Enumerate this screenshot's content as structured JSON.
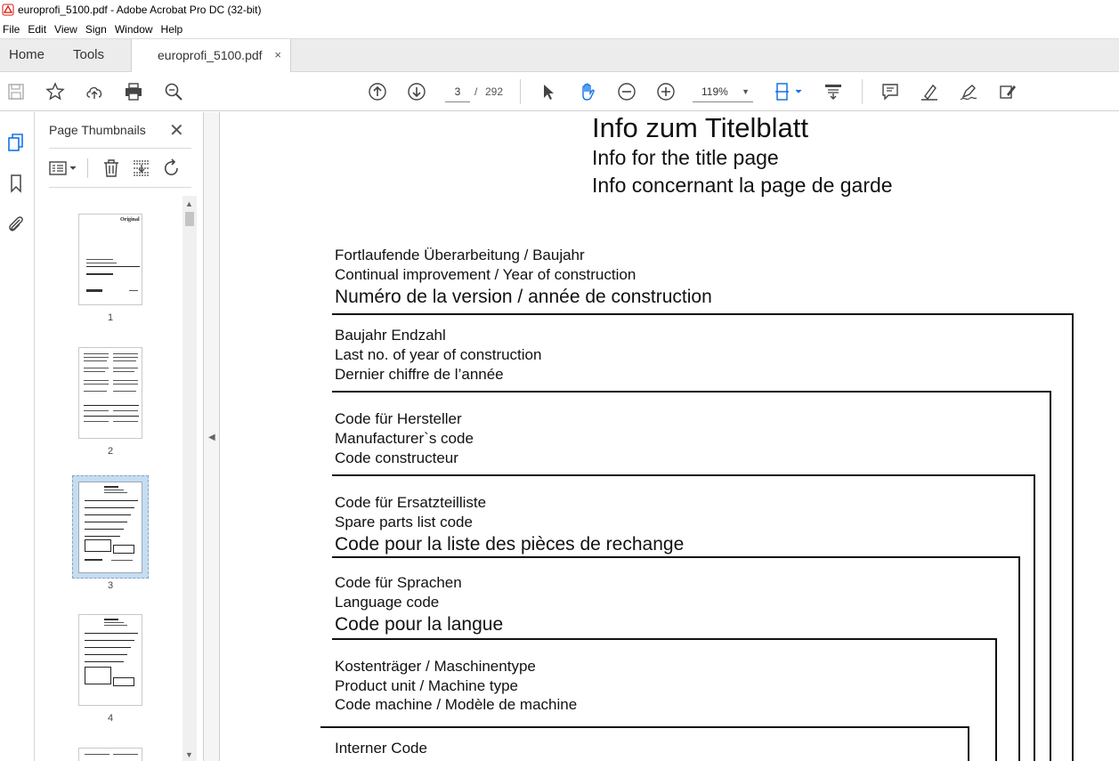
{
  "window": {
    "title": "europrofi_5100.pdf - Adobe Acrobat Pro DC (32-bit)"
  },
  "menu": {
    "items": [
      "File",
      "Edit",
      "View",
      "Sign",
      "Window",
      "Help"
    ]
  },
  "tabs": {
    "home": "Home",
    "tools": "Tools",
    "document": "europrofi_5100.pdf",
    "close_glyph": "×"
  },
  "toolbar": {
    "current_page": "3",
    "page_separator": "/",
    "total_pages": "292",
    "zoom": "119%",
    "accent_color": "#1473e6"
  },
  "thumbnails_panel": {
    "title": "Page Thumbnails",
    "close_glyph": "✕",
    "pages": [
      {
        "label": "1"
      },
      {
        "label": "2"
      },
      {
        "label": "3",
        "selected": true
      },
      {
        "label": "4"
      }
    ],
    "page1_mark": "Original"
  },
  "document": {
    "title": "Info  zum  Titelblatt",
    "subtitle_en": "Info for the title page",
    "subtitle_fr": "Info concernant la page de garde",
    "sections": [
      {
        "de": "Fortlaufende Überarbeitung / Baujahr",
        "en": "Continual improvement / Year of construction",
        "fr": "Numéro de la version / année de construction"
      },
      {
        "de": "Baujahr Endzahl",
        "en": "Last no. of year of construction",
        "fr": "Dernier chiffre de l’année"
      },
      {
        "de": "Code für Hersteller",
        "en": "Manufacturer`s  code",
        "fr": "Code constructeur"
      },
      {
        "de": "Code für Ersatzteilliste",
        "en": "Spare parts list code",
        "fr": "Code pour la liste des pièces de rechange"
      },
      {
        "de": "Code für Sprachen",
        "en": "Language code",
        "fr": "Code pour la langue"
      },
      {
        "de": "Kostenträger / Maschinentype",
        "en": "Product unit / Machine type",
        "fr": "Code machine / Modèle de machine"
      },
      {
        "de": "Interner Code"
      }
    ]
  }
}
